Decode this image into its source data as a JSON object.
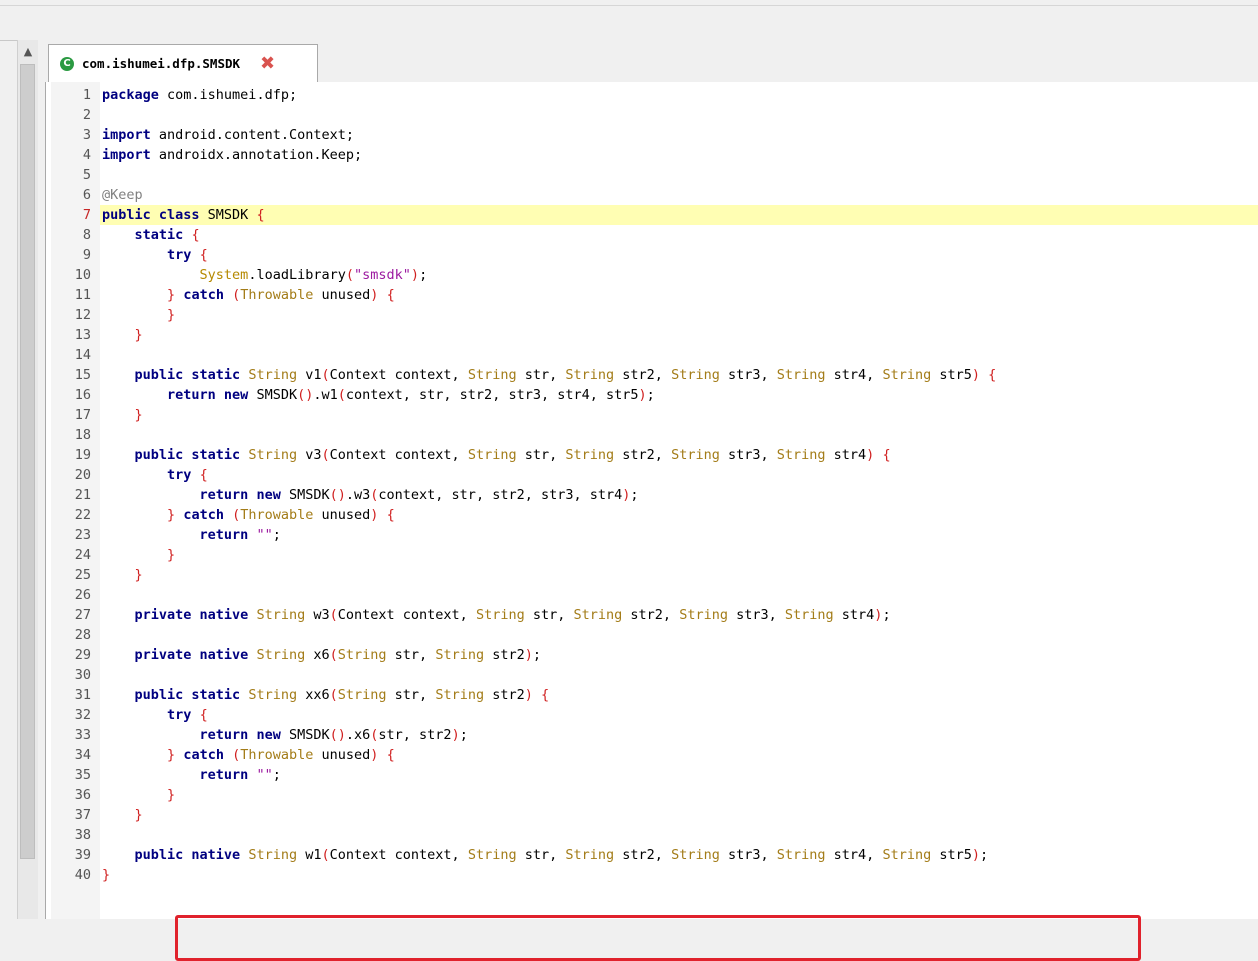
{
  "tab": {
    "icon": "class-icon",
    "icon_letter": "C",
    "title": "com.ishumei.dfp.SMSDK",
    "close_icon": "close-icon"
  },
  "editor": {
    "highlighted_line": 7,
    "boxed_line": 39,
    "lines": [
      {
        "n": "1",
        "html": "<span class='kw'>package</span> com.ishumei.dfp;"
      },
      {
        "n": "2",
        "html": ""
      },
      {
        "n": "3",
        "html": "<span class='kw'>import</span> android.content.Context;"
      },
      {
        "n": "4",
        "html": "<span class='kw'>import</span> androidx.annotation.Keep;"
      },
      {
        "n": "5",
        "html": ""
      },
      {
        "n": "6",
        "html": "<span class='ann'>@Keep</span>"
      },
      {
        "n": "7",
        "html": "<span class='kw'>public class</span> SMSDK <span class='br'>{</span>"
      },
      {
        "n": "8",
        "html": "    <span class='kw'>static</span> <span class='br'>{</span>"
      },
      {
        "n": "9",
        "html": "        <span class='kw'>try</span> <span class='br'>{</span>"
      },
      {
        "n": "10",
        "html": "            <span class='sys'>System</span>.loadLibrary<span class='br'>(</span><span class='str'>\"smsdk\"</span><span class='br'>)</span>;"
      },
      {
        "n": "11",
        "html": "        <span class='br'>}</span> <span class='kw'>catch</span> <span class='br'>(</span><span class='type'>Throwable</span> unused<span class='br'>)</span> <span class='br'>{</span>"
      },
      {
        "n": "12",
        "html": "        <span class='br'>}</span>"
      },
      {
        "n": "13",
        "html": "    <span class='br'>}</span>"
      },
      {
        "n": "14",
        "html": ""
      },
      {
        "n": "15",
        "html": "    <span class='kw'>public static</span> <span class='type'>String</span> v1<span class='br'>(</span>Context context, <span class='type'>String</span> str, <span class='type'>String</span> str2, <span class='type'>String</span> str3, <span class='type'>String</span> str4, <span class='type'>String</span> str5<span class='br'>)</span> <span class='br'>{</span>"
      },
      {
        "n": "16",
        "html": "        <span class='kw'>return new</span> SMSDK<span class='br'>()</span>.w1<span class='br'>(</span>context, str, str2, str3, str4, str5<span class='br'>)</span>;"
      },
      {
        "n": "17",
        "html": "    <span class='br'>}</span>"
      },
      {
        "n": "18",
        "html": ""
      },
      {
        "n": "19",
        "html": "    <span class='kw'>public static</span> <span class='type'>String</span> v3<span class='br'>(</span>Context context, <span class='type'>String</span> str, <span class='type'>String</span> str2, <span class='type'>String</span> str3, <span class='type'>String</span> str4<span class='br'>)</span> <span class='br'>{</span>"
      },
      {
        "n": "20",
        "html": "        <span class='kw'>try</span> <span class='br'>{</span>"
      },
      {
        "n": "21",
        "html": "            <span class='kw'>return new</span> SMSDK<span class='br'>()</span>.w3<span class='br'>(</span>context, str, str2, str3, str4<span class='br'>)</span>;"
      },
      {
        "n": "22",
        "html": "        <span class='br'>}</span> <span class='kw'>catch</span> <span class='br'>(</span><span class='type'>Throwable</span> unused<span class='br'>)</span> <span class='br'>{</span>"
      },
      {
        "n": "23",
        "html": "            <span class='kw'>return</span> <span class='str'>\"\"</span>;"
      },
      {
        "n": "24",
        "html": "        <span class='br'>}</span>"
      },
      {
        "n": "25",
        "html": "    <span class='br'>}</span>"
      },
      {
        "n": "26",
        "html": ""
      },
      {
        "n": "27",
        "html": "    <span class='kw'>private native</span> <span class='type'>String</span> w3<span class='br'>(</span>Context context, <span class='type'>String</span> str, <span class='type'>String</span> str2, <span class='type'>String</span> str3, <span class='type'>String</span> str4<span class='br'>)</span>;"
      },
      {
        "n": "28",
        "html": ""
      },
      {
        "n": "29",
        "html": "    <span class='kw'>private native</span> <span class='type'>String</span> x6<span class='br'>(</span><span class='type'>String</span> str, <span class='type'>String</span> str2<span class='br'>)</span>;"
      },
      {
        "n": "30",
        "html": ""
      },
      {
        "n": "31",
        "html": "    <span class='kw'>public static</span> <span class='type'>String</span> xx6<span class='br'>(</span><span class='type'>String</span> str, <span class='type'>String</span> str2<span class='br'>)</span> <span class='br'>{</span>"
      },
      {
        "n": "32",
        "html": "        <span class='kw'>try</span> <span class='br'>{</span>"
      },
      {
        "n": "33",
        "html": "            <span class='kw'>return new</span> SMSDK<span class='br'>()</span>.x6<span class='br'>(</span>str, str2<span class='br'>)</span>;"
      },
      {
        "n": "34",
        "html": "        <span class='br'>}</span> <span class='kw'>catch</span> <span class='br'>(</span><span class='type'>Throwable</span> unused<span class='br'>)</span> <span class='br'>{</span>"
      },
      {
        "n": "35",
        "html": "            <span class='kw'>return</span> <span class='str'>\"\"</span>;"
      },
      {
        "n": "36",
        "html": "        <span class='br'>}</span>"
      },
      {
        "n": "37",
        "html": "    <span class='br'>}</span>"
      },
      {
        "n": "38",
        "html": ""
      },
      {
        "n": "39",
        "html": "    <span class='kw'>public native</span> <span class='type'>String</span> w1<span class='br'>(</span>Context context, <span class='type'>String</span> str, <span class='type'>String</span> str2, <span class='type'>String</span> str3, <span class='type'>String</span> str4, <span class='type'>String</span> str5<span class='br'>)</span>;"
      },
      {
        "n": "40",
        "html": "<span class='br'>}</span>"
      }
    ]
  },
  "colors": {
    "keyword": "#000080",
    "type": "#a37c18",
    "string": "#9c1aa0",
    "bracket": "#d02020",
    "annotation": "#808080",
    "line_highlight": "#fffeb3",
    "annotation_box": "#e0222c"
  }
}
